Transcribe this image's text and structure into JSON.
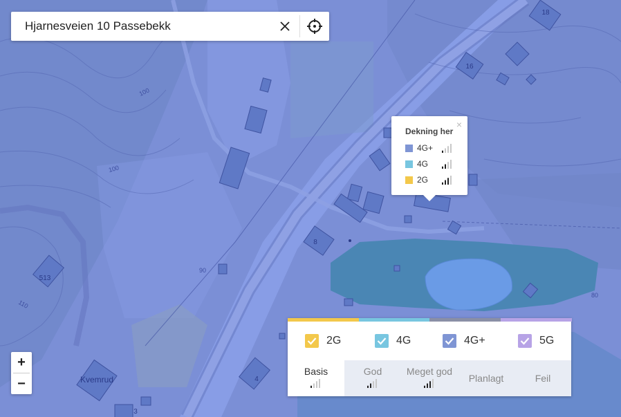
{
  "search": {
    "value": "Hjarnesveien 10 Passebekk"
  },
  "icons": {
    "clear": "close-icon",
    "locate": "crosshair-icon"
  },
  "zoom": {
    "in_label": "+",
    "out_label": "−"
  },
  "map_labels": {
    "house_numbers": [
      "18",
      "16",
      "8",
      "513",
      "4",
      "3"
    ],
    "place_name": "Kvemrud",
    "contours": [
      "100",
      "100",
      "90",
      "110",
      "80"
    ]
  },
  "popup": {
    "title": "Dekning her",
    "close_label": "×",
    "rows": [
      {
        "label": "4G+",
        "color": "#7f95d4",
        "signal": 1
      },
      {
        "label": "4G",
        "color": "#78c6e0",
        "signal": 2
      },
      {
        "label": "2G",
        "color": "#f3c84b",
        "signal": 3
      }
    ]
  },
  "legend": {
    "items": [
      {
        "label": "2G",
        "color": "#f3c84b",
        "checked": true
      },
      {
        "label": "4G",
        "color": "#78c6e0",
        "checked": true
      },
      {
        "label": "4G+",
        "color": "#7f95d4",
        "checked": true
      },
      {
        "label": "5G",
        "color": "#b7a3e6",
        "checked": true
      }
    ],
    "tabs": [
      {
        "label": "Basis",
        "signal": 1,
        "active": true
      },
      {
        "label": "God",
        "signal": 2,
        "active": false
      },
      {
        "label": "Meget god",
        "signal": 3,
        "active": false
      },
      {
        "label": "Planlagt",
        "signal": null,
        "active": false
      },
      {
        "label": "Feil",
        "signal": null,
        "active": false
      }
    ]
  },
  "colors": {
    "coverage_base": "#7b8fd6",
    "coverage_light": "#8a9ee8",
    "coverage_dark": "#6f86c7",
    "water": "#4a86b4",
    "lake": "#6a9be6",
    "building": "#5f79c6"
  }
}
